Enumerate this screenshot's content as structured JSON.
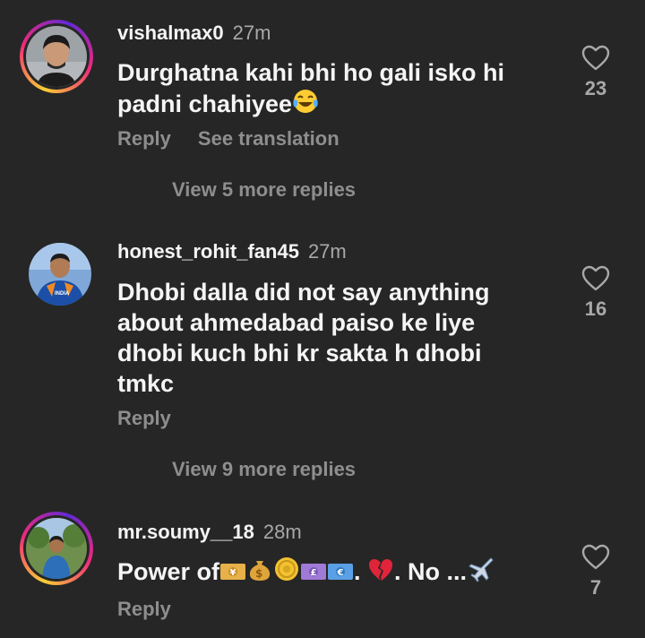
{
  "comments": [
    {
      "username": "vishalmax0",
      "time": "27m",
      "lines": [
        "Durghatna kahi bhi ho gali isko hi",
        "padni chahiyee"
      ],
      "likes": "23",
      "actions": [
        "Reply",
        "See translation"
      ],
      "view_replies": "View 5 more replies",
      "avatar_icon": "profile-photo-man",
      "has_story_ring": true
    },
    {
      "username": "honest_rohit_fan45",
      "time": "27m",
      "lines": [
        "Dhobi dalla did not say anything",
        "about ahmedabad paiso ke liye",
        "dhobi kuch bhi kr sakta h dhobi",
        "tmkc"
      ],
      "likes": "16",
      "actions": [
        "Reply"
      ],
      "view_replies": "View 9 more replies",
      "avatar_icon": "profile-photo-cricketer",
      "has_story_ring": false
    },
    {
      "username": "mr.soumy__18",
      "time": "28m",
      "text_prefix": "Power of",
      "text_mid": ". ",
      "text_suffix": ". No ...",
      "likes": "7",
      "actions": [
        "Reply"
      ],
      "avatar_icon": "profile-photo-outdoor",
      "has_story_ring": true
    }
  ],
  "colors": {
    "background": "#262626",
    "primary_text": "#f5f5f5",
    "secondary_text": "#8e8e8e",
    "heart_outline": "#a8a8a8"
  },
  "icons": {
    "like": "heart-outline-icon",
    "emoji_1": "laughing-tears-emoji",
    "emoji_money": [
      "yen-banknote-emoji",
      "money-bag-emoji",
      "coin-emoji",
      "pound-banknote-emoji",
      "euro-banknote-emoji"
    ],
    "emoji_heart": "broken-heart-emoji",
    "emoji_plane": "airplane-emoji"
  }
}
